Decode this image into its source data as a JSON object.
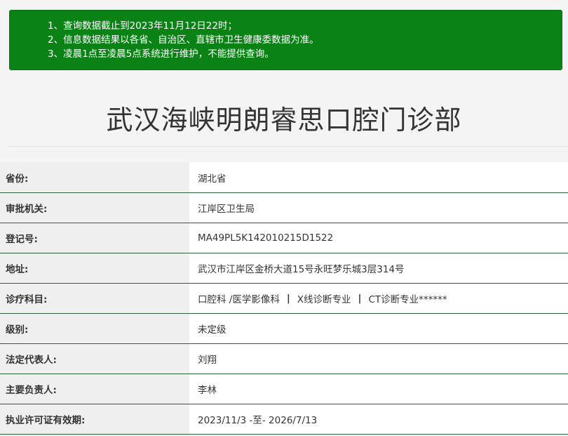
{
  "notice": {
    "lines": [
      "1、查询数据截止到2023年11月12日22时；",
      "2、信息数据结果以各省、自治区、直辖市卫生健康委数据为准。",
      "3、凌晨1点至凌晨5点系统进行维护，不能提供查询。"
    ],
    "background_color": "#0a8215"
  },
  "title": "武汉海峡明朗睿思口腔门诊部",
  "fields": [
    {
      "label": "省份:",
      "value": "湖北省"
    },
    {
      "label": "审批机关:",
      "value": "江岸区卫生局"
    },
    {
      "label": "登记号:",
      "value": "MA49PL5K142010215D1522"
    },
    {
      "label": "地址:",
      "value": "武汉市江岸区金桥大道15号永旺梦乐城3层314号"
    },
    {
      "label": "诊疗科目:",
      "subjects": [
        "口腔科 /医学影像科",
        "X线诊断专业",
        "CT诊断专业******"
      ],
      "separator": "|"
    },
    {
      "label": "级别:",
      "value": "未定级"
    },
    {
      "label": "法定代表人:",
      "value": "刘翔"
    },
    {
      "label": "主要负责人:",
      "value": "李林"
    },
    {
      "label": "执业许可证有效期:",
      "value": "2023/11/3 -至- 2026/7/13"
    }
  ],
  "row_border_color": "#2f5d3d"
}
